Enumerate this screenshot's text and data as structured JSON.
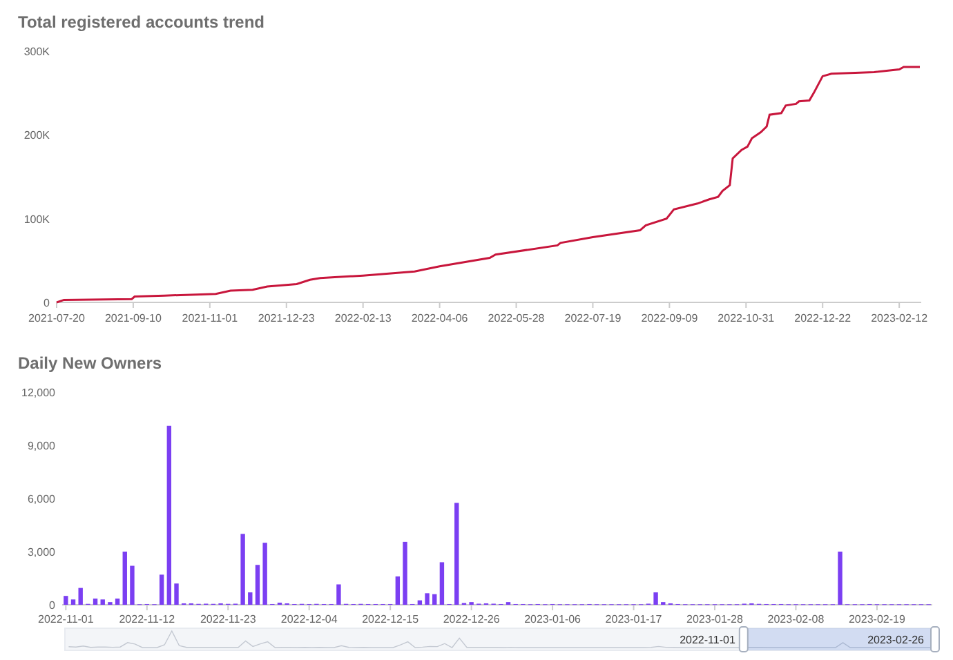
{
  "charts": [
    {
      "title": "Total registered accounts trend",
      "chart_data": {
        "type": "line",
        "x": [
          "2021-07-20",
          "2021-07-25",
          "2021-09-09",
          "2021-09-11",
          "2021-10-01",
          "2021-11-05",
          "2021-11-15",
          "2021-11-30",
          "2021-12-10",
          "2021-12-30",
          "2022-01-08",
          "2022-01-15",
          "2022-02-13",
          "2022-03-20",
          "2022-04-06",
          "2022-05-10",
          "2022-05-14",
          "2022-06-25",
          "2022-06-27",
          "2022-07-19",
          "2022-08-20",
          "2022-08-24",
          "2022-09-07",
          "2022-09-12",
          "2022-09-28",
          "2022-10-06",
          "2022-10-12",
          "2022-10-15",
          "2022-10-20",
          "2022-10-22",
          "2022-10-28",
          "2022-11-01",
          "2022-11-04",
          "2022-11-10",
          "2022-11-14",
          "2022-11-16",
          "2022-11-24",
          "2022-11-27",
          "2022-12-04",
          "2022-12-06",
          "2022-12-13",
          "2022-12-16",
          "2022-12-22",
          "2022-12-28",
          "2023-01-26",
          "2023-02-12",
          "2023-02-15",
          "2023-02-26"
        ],
        "series": [
          {
            "color": "#c8163c",
            "values": [
              0,
              3000,
              4000,
              7000,
              8000,
              10000,
              14000,
              15000,
              19000,
              22000,
              27000,
              29000,
              32000,
              37000,
              43000,
              53000,
              57000,
              68000,
              71000,
              78000,
              86000,
              92000,
              100000,
              111000,
              118000,
              123000,
              126000,
              133000,
              140000,
              172000,
              182000,
              186000,
              196000,
              203000,
              210000,
              224000,
              226000,
              235000,
              237000,
              240000,
              241000,
              250000,
              270000,
              273000,
              275000,
              278000,
              281000,
              281000
            ]
          }
        ],
        "xlim": [
          "2021-07-20",
          "2023-02-26"
        ],
        "ylim": [
          0,
          300000
        ],
        "xticks": [
          "2021-07-20",
          "2021-09-10",
          "2021-11-01",
          "2021-12-23",
          "2022-02-13",
          "2022-04-06",
          "2022-05-28",
          "2022-07-19",
          "2022-09-09",
          "2022-10-31",
          "2022-12-22",
          "2023-02-12"
        ],
        "yticks": [
          {
            "value": 0,
            "label": "0"
          },
          {
            "value": 100000,
            "label": "100K"
          },
          {
            "value": 200000,
            "label": "200K"
          },
          {
            "value": 300000,
            "label": "300K"
          }
        ]
      }
    },
    {
      "title": "Daily New Owners",
      "chart_data": {
        "type": "bar",
        "categories": [
          "2022-11-01",
          null,
          null,
          null,
          null,
          null,
          null,
          null,
          null,
          null,
          null,
          "2022-11-12",
          null,
          null,
          null,
          null,
          null,
          null,
          null,
          null,
          null,
          null,
          "2022-11-23",
          null,
          null,
          null,
          null,
          null,
          null,
          null,
          null,
          null,
          null,
          "2022-12-04",
          null,
          null,
          null,
          null,
          null,
          null,
          null,
          null,
          null,
          null,
          "2022-12-15",
          null,
          null,
          null,
          null,
          null,
          null,
          null,
          null,
          null,
          null,
          "2022-12-26",
          null,
          null,
          null,
          null,
          null,
          null,
          null,
          null,
          null,
          null,
          "2023-01-06",
          null,
          null,
          null,
          null,
          null,
          null,
          null,
          null,
          null,
          null,
          "2023-01-17",
          null,
          null,
          null,
          null,
          null,
          null,
          null,
          null,
          null,
          null,
          "2023-01-28",
          null,
          null,
          null,
          null,
          null,
          null,
          null,
          null,
          null,
          null,
          "2023-02-08",
          null,
          null,
          null,
          null,
          null,
          null,
          null,
          null,
          null,
          null,
          "2023-02-19",
          null,
          null,
          null,
          null,
          null,
          null,
          null
        ],
        "series": [
          {
            "color": "#7b3ff2",
            "values": [
              500,
              300,
              950,
              50,
              350,
              300,
              150,
              350,
              3000,
              2200,
              30,
              40,
              30,
              1700,
              10100,
              1200,
              80,
              80,
              50,
              60,
              50,
              80,
              50,
              60,
              4000,
              700,
              2250,
              3500,
              40,
              120,
              80,
              40,
              50,
              40,
              50,
              40,
              40,
              1150,
              50,
              40,
              50,
              40,
              40,
              40,
              40,
              1600,
              3550,
              40,
              250,
              650,
              600,
              2400,
              40,
              5750,
              100,
              150,
              60,
              80,
              60,
              40,
              150,
              40,
              40,
              30,
              40,
              30,
              40,
              30,
              30,
              30,
              30,
              40,
              30,
              30,
              30,
              30,
              30,
              30,
              30,
              60,
              700,
              150,
              80,
              40,
              30,
              30,
              30,
              30,
              30,
              30,
              30,
              30,
              60,
              80,
              50,
              40,
              40,
              40,
              30,
              30,
              30,
              30,
              30,
              30,
              30,
              3000,
              30,
              30,
              30,
              40,
              30,
              30,
              30,
              30,
              30,
              30,
              30,
              30
            ]
          }
        ],
        "ylim": [
          0,
          12000
        ],
        "yticks": [
          {
            "value": 0,
            "label": "0"
          },
          {
            "value": 3000,
            "label": "3,000"
          },
          {
            "value": 6000,
            "label": "6,000"
          },
          {
            "value": 9000,
            "label": "9,000"
          },
          {
            "value": 12000,
            "label": "12,000"
          }
        ]
      },
      "data_zoom": {
        "start_label": "2022-11-01",
        "end_label": "2023-02-26",
        "level": 0.22
      }
    }
  ]
}
